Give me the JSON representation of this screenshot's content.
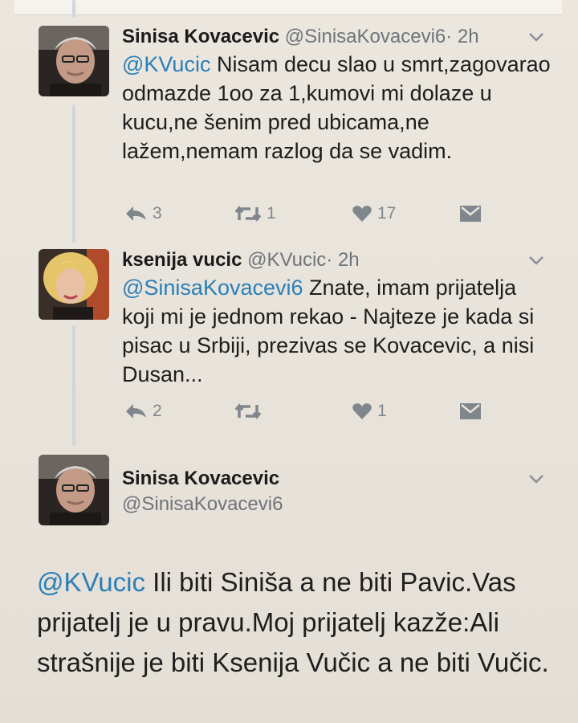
{
  "tweets": [
    {
      "name": "Sinisa Kovacevic",
      "handle": "@SinisaKovacevi6",
      "time": "· 2h",
      "mention": "@KVucic",
      "text": "Nisam decu slao u smrt,zagovarao odmazde 1oo za 1,kumovi mi dolaze u kucu,ne šenim pred ubicama,ne lažem,nemam razlog da se vadim.",
      "reply_count": "3",
      "retweet_count": "1",
      "like_count": "17"
    },
    {
      "name": "ksenija vucic",
      "handle": "@KVucic",
      "time": "· 2h",
      "mention": "@SinisaKovacevi6",
      "text": "Znate, imam prijatelja koji mi je jednom rekao - Najteze je kada si pisac u Srbiji, prezivas se Kovacevic, a nisi Dusan...",
      "reply_count": "2",
      "retweet_count": "",
      "like_count": "1"
    },
    {
      "name": "Sinisa Kovacevic",
      "handle": "@SinisaKovacevi6",
      "mention": "@KVucic",
      "text": "Ili biti Siniša a ne biti Pavic.Vas prijatelj je u pravu.Moj prijatelj kazže:Ali strašnije je biti Ksenija Vučic a ne biti Vučic."
    }
  ],
  "colors": {
    "mention": "#2a7fb8",
    "action_grey": "#7f878c",
    "thread_line": "#cfd7dc"
  },
  "icons": [
    "reply-icon",
    "retweet-icon",
    "heart-icon",
    "message-icon",
    "chevron-down-icon"
  ]
}
